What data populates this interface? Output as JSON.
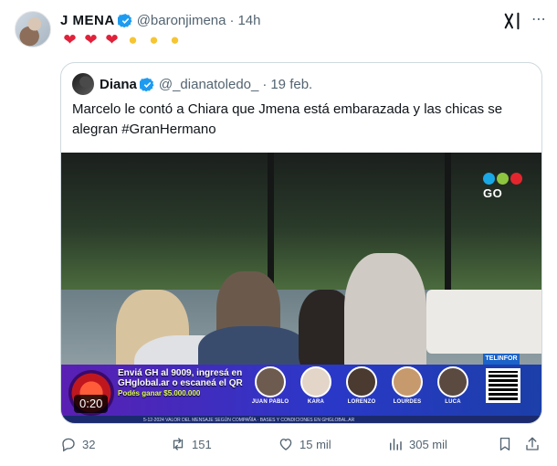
{
  "author": {
    "name": "J MENA",
    "handle": "@baronjimena",
    "time": "14h"
  },
  "tweet": {
    "emojis": [
      "heart",
      "heart",
      "heart",
      "chick",
      "chick",
      "chick"
    ]
  },
  "quoted": {
    "name": "Diana",
    "handle": "@_dianatoledo_",
    "time": "19 feb.",
    "text": "Marcelo le contó a Chiara que Jmena está embarazada y las chicas se alegran #GranHermano",
    "video": {
      "timestamp": "0:20",
      "channel_logo": "GO",
      "promo_line1": "Enviá GH al 9009, ingresá en",
      "promo_line2": "GHglobal.ar o escaneá el QR",
      "promo_line3": "Podés ganar $5.000.000",
      "sponsor": "TELINFOR",
      "contestants": [
        "JUAN PABLO",
        "KARA",
        "LORENZO",
        "LOURDES",
        "LUCA"
      ],
      "ticker": "5-12-2024 VALOR DEL MENSAJE SEGÚN COMPAÑÍA · BASES Y CONDICIONES EN GHGLOBAL.AR"
    }
  },
  "stats": {
    "replies": "32",
    "reposts": "151",
    "likes": "15 mil",
    "views": "305 mil"
  },
  "colors": {
    "text": "#0f1419",
    "secondary": "#536471",
    "verified": "#1d9bf0",
    "border": "#cfd9de",
    "heart": "#e0223a"
  }
}
